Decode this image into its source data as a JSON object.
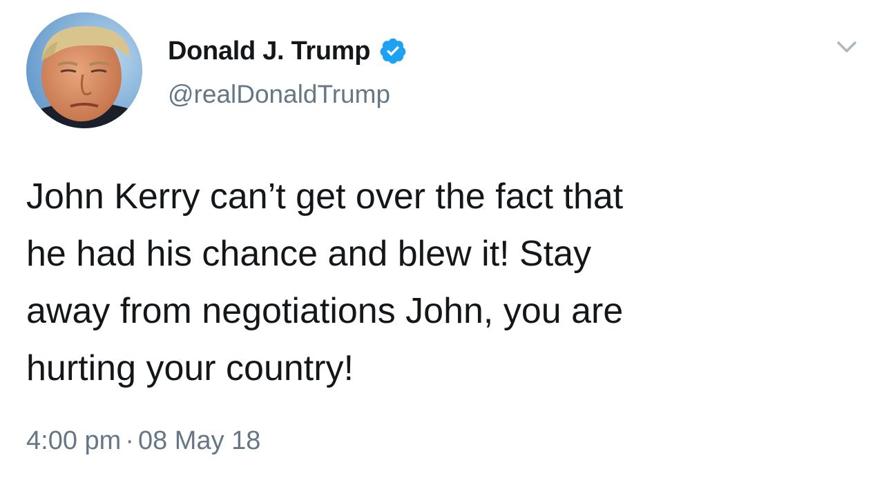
{
  "author": {
    "display_name": "Donald J. Trump",
    "handle": "@realDonaldTrump",
    "verified": true,
    "avatar_icon": "profile-photo",
    "verified_icon": "verified-badge-icon",
    "menu_icon": "chevron-down-icon"
  },
  "tweet": {
    "lines": [
      "John Kerry can’t get over the fact that",
      "he had his chance and blew it! Stay",
      "away from negotiations John, you are",
      "hurting your country!"
    ]
  },
  "meta": {
    "time": "4:00 pm",
    "separator": "·",
    "date": "08 May 18"
  },
  "colors": {
    "text": "#14171a",
    "secondary": "#657786",
    "verified_blue": "#1da1f2",
    "background": "#ffffff"
  }
}
